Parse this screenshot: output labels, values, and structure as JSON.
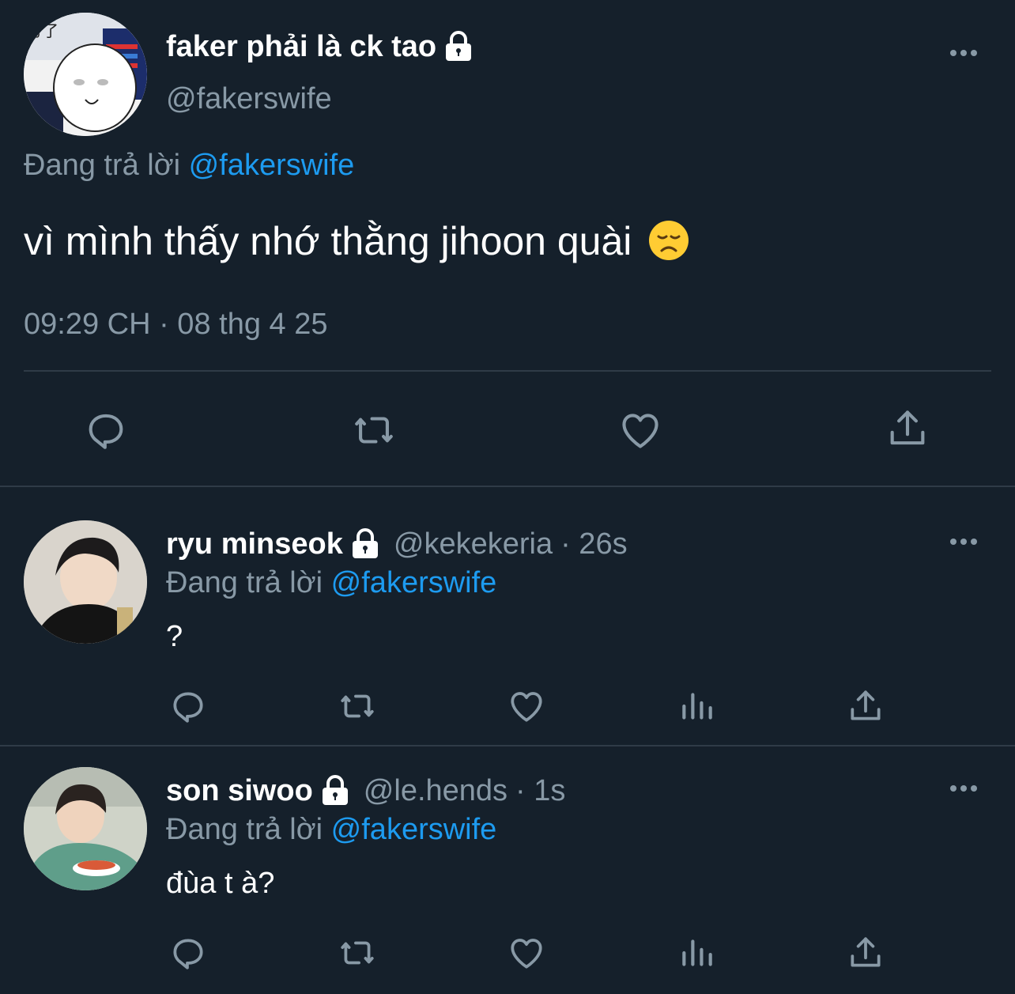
{
  "main_tweet": {
    "display_name": "faker phải là ck tao",
    "handle": "@fakerswife",
    "reply_prefix": "Đang trả lời",
    "reply_to": "@fakerswife",
    "text": "vì mình thấy nhớ thằng jihoon quài",
    "timestamp": "09:29 CH · 08 thg 4 25"
  },
  "replies": [
    {
      "display_name": "ryu minseok",
      "handle": "@kekekeria",
      "time": "· 26s",
      "reply_prefix": "Đang trả lời",
      "reply_to": "@fakerswife",
      "text": "?"
    },
    {
      "display_name": "son siwoo",
      "handle": "@le.hends",
      "time": "· 1s",
      "reply_prefix": "Đang trả lời",
      "reply_to": "@fakerswife",
      "text": "đùa t à?"
    }
  ],
  "icons": {
    "reply": "reply-icon",
    "retweet": "retweet-icon",
    "like": "heart-icon",
    "views": "views-icon",
    "share": "share-icon",
    "lock": "lock-icon",
    "more": "more-icon"
  },
  "colors": {
    "background": "#15202b",
    "accent": "#1d9bf0",
    "muted": "#8899a6",
    "divider": "#2f3b47"
  }
}
